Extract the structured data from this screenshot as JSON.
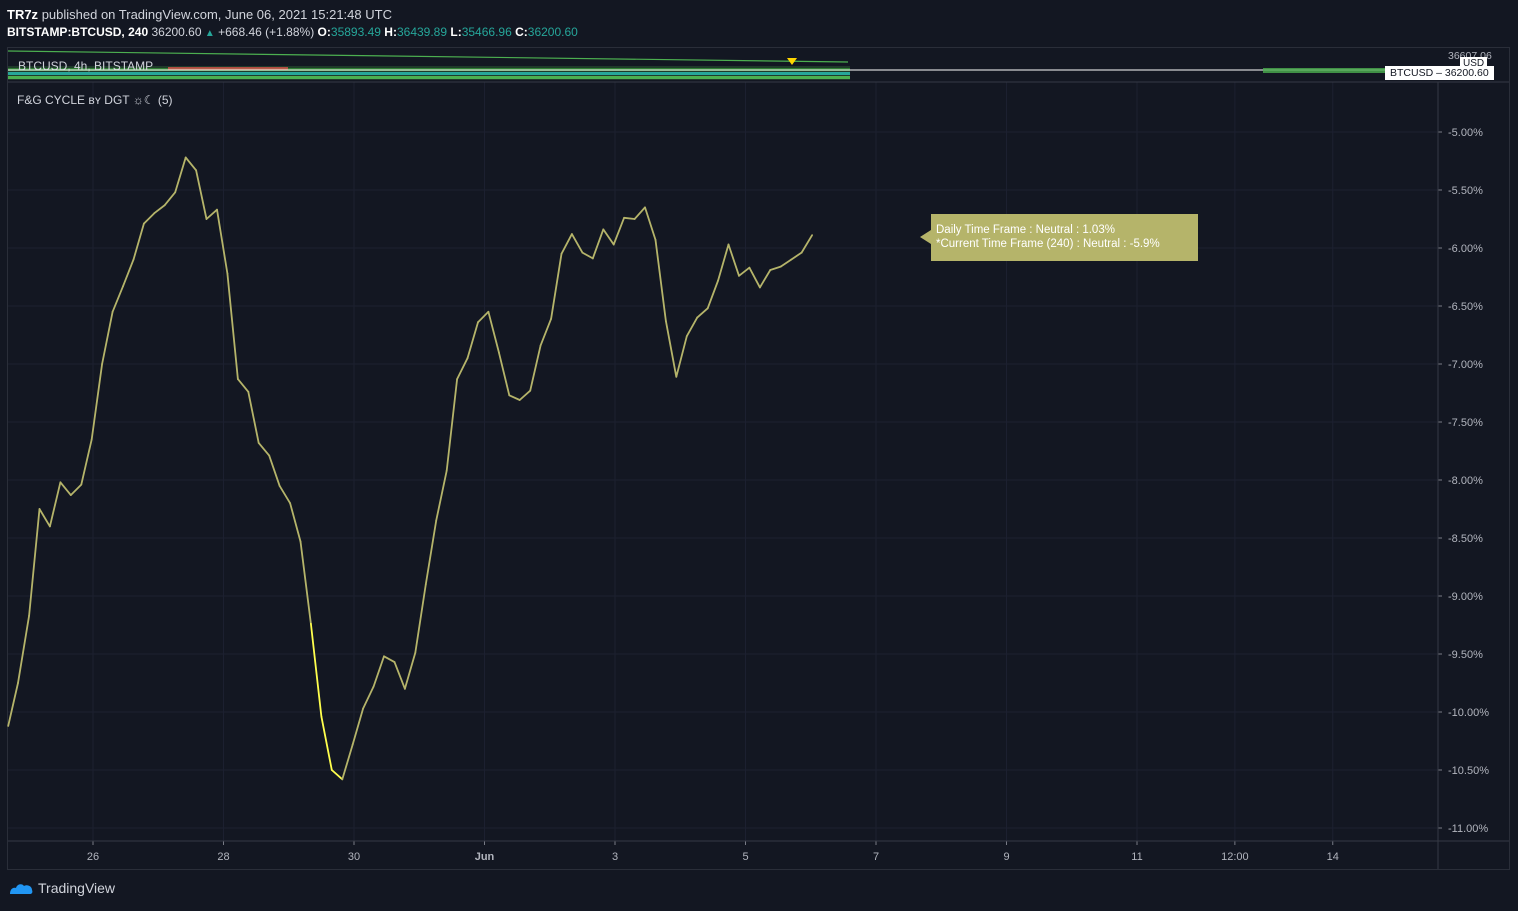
{
  "header": {
    "publisher": "TR7z",
    "published_text": "published on TradingView.com, June 06, 2021 15:21:48 UTC",
    "symbol": "BITSTAMP:BTCUSD, 240",
    "last": "36200.60",
    "change": "+668.46 (+1.88%)",
    "o_label": "O:",
    "o": "35893.49",
    "h_label": "H:",
    "h": "36439.89",
    "l_label": "L:",
    "l": "35466.96",
    "c_label": "C:",
    "c": "36200.60"
  },
  "price_pane": {
    "label": "BTCUSD, 4h, BITSTAMP",
    "currency": "USD",
    "top_price": "36607.06",
    "symbol_tag": "BTCUSD",
    "symbol_tag_price": "36200.60"
  },
  "indicator": {
    "title": "F&G CYCLE ʙʏ DGT ☼☾ (5)"
  },
  "tooltip": {
    "line1": "Daily Time Frame : Neutral : 1.03%",
    "line2": "*Current Time Frame (240) : Neutral : -5.9%"
  },
  "footer": {
    "brand": "TradingView"
  },
  "colors": {
    "line": "#b5b46a",
    "highlight": "#ffff4d",
    "background": "#131722",
    "up": "#26a69a"
  },
  "chart_data": {
    "type": "line",
    "y_unit": "%",
    "ylim": [
      -11.3,
      -4.6
    ],
    "y_ticks": [
      "-5.00%",
      "-5.50%",
      "-6.00%",
      "-6.50%",
      "-7.00%",
      "-7.50%",
      "-8.00%",
      "-8.50%",
      "-9.00%",
      "-9.50%",
      "-10.00%",
      "-10.50%",
      "-11.00%"
    ],
    "y_tick_values": [
      -5,
      -5.5,
      -6,
      -6.5,
      -7,
      -7.5,
      -8,
      -8.5,
      -9,
      -9.5,
      -10,
      -10.5,
      -11
    ],
    "x_ticks": [
      "26",
      "28",
      "30",
      "Jun",
      "3",
      "5",
      "7",
      "9",
      "11",
      "12:00",
      "14"
    ],
    "x_tick_positions": [
      26,
      28,
      30,
      32,
      34,
      36,
      38,
      40,
      42,
      43.5,
      45
    ],
    "xlim": [
      24.7,
      46.6
    ],
    "series": [
      {
        "values": [
          [
            24.7,
            -10.12
          ],
          [
            24.85,
            -9.75
          ],
          [
            25.02,
            -9.17
          ],
          [
            25.18,
            -8.25
          ],
          [
            25.34,
            -8.4
          ],
          [
            25.5,
            -8.02
          ],
          [
            25.66,
            -8.13
          ],
          [
            25.82,
            -8.04
          ],
          [
            25.98,
            -7.65
          ],
          [
            26.14,
            -7.0
          ],
          [
            26.3,
            -6.55
          ],
          [
            26.46,
            -6.33
          ],
          [
            26.62,
            -6.1
          ],
          [
            26.78,
            -5.79
          ],
          [
            26.94,
            -5.7
          ],
          [
            27.1,
            -5.63
          ],
          [
            27.26,
            -5.52
          ],
          [
            27.42,
            -5.22
          ],
          [
            27.58,
            -5.33
          ],
          [
            27.74,
            -5.75
          ],
          [
            27.9,
            -5.67
          ],
          [
            28.06,
            -6.22
          ],
          [
            28.22,
            -7.13
          ],
          [
            28.38,
            -7.24
          ],
          [
            28.54,
            -7.68
          ],
          [
            28.7,
            -7.79
          ],
          [
            28.86,
            -8.05
          ],
          [
            29.02,
            -8.2
          ],
          [
            29.18,
            -8.53
          ],
          [
            29.34,
            -9.24
          ],
          [
            29.5,
            -10.04
          ],
          [
            29.66,
            -10.5
          ],
          [
            29.82,
            -10.58
          ],
          [
            29.98,
            -10.28
          ],
          [
            30.14,
            -9.97
          ],
          [
            30.3,
            -9.78
          ],
          [
            30.46,
            -9.52
          ],
          [
            30.62,
            -9.57
          ],
          [
            30.78,
            -9.8
          ],
          [
            30.94,
            -9.49
          ],
          [
            31.1,
            -8.9
          ],
          [
            31.26,
            -8.35
          ],
          [
            31.42,
            -7.92
          ],
          [
            31.58,
            -7.13
          ],
          [
            31.74,
            -6.95
          ],
          [
            31.9,
            -6.64
          ],
          [
            32.06,
            -6.55
          ],
          [
            32.22,
            -6.9
          ],
          [
            32.38,
            -7.27
          ],
          [
            32.54,
            -7.31
          ],
          [
            32.7,
            -7.23
          ],
          [
            32.86,
            -6.84
          ],
          [
            33.02,
            -6.61
          ],
          [
            33.18,
            -6.05
          ],
          [
            33.34,
            -5.88
          ],
          [
            33.5,
            -6.04
          ],
          [
            33.66,
            -6.09
          ],
          [
            33.82,
            -5.84
          ],
          [
            33.98,
            -5.97
          ],
          [
            34.14,
            -5.74
          ],
          [
            34.3,
            -5.75
          ],
          [
            34.46,
            -5.65
          ],
          [
            34.62,
            -5.93
          ],
          [
            34.78,
            -6.63
          ],
          [
            34.94,
            -7.11
          ],
          [
            35.1,
            -6.76
          ],
          [
            35.26,
            -6.6
          ],
          [
            35.42,
            -6.52
          ],
          [
            35.58,
            -6.28
          ],
          [
            35.74,
            -5.97
          ],
          [
            35.9,
            -6.24
          ],
          [
            36.06,
            -6.17
          ],
          [
            36.22,
            -6.34
          ],
          [
            36.38,
            -6.19
          ],
          [
            36.54,
            -6.16
          ],
          [
            36.7,
            -6.1
          ],
          [
            36.86,
            -6.04
          ],
          [
            37.02,
            -5.89
          ]
        ]
      }
    ],
    "highlight_range": [
      29.34,
      29.82
    ],
    "grid": true,
    "title": "F&G CYCLE ʙʏ DGT ☼☾ (5)"
  }
}
